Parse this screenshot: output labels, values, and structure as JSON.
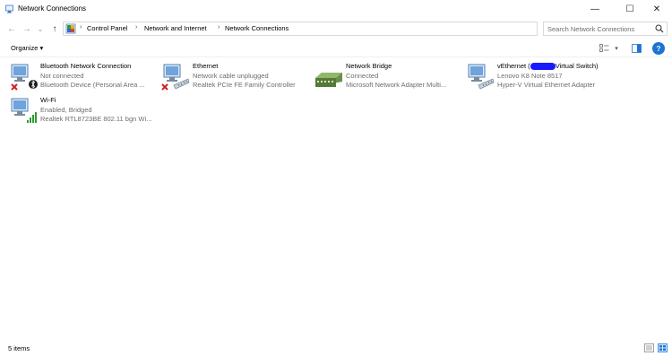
{
  "window": {
    "title": "Network Connections",
    "minimize": "—",
    "maximize": "☐",
    "close": "✕"
  },
  "nav": {
    "back": "←",
    "forward": "→",
    "recent": "⌄",
    "up": "↑"
  },
  "breadcrumb": {
    "separator": "›",
    "items": [
      "Control Panel",
      "Network and Internet",
      "Network Connections"
    ]
  },
  "search": {
    "placeholder": "Search Network Connections"
  },
  "command_bar": {
    "organize": "Organize ▾"
  },
  "connections": [
    {
      "name": "Bluetooth Network Connection",
      "status": "Not connected",
      "device": "Bluetooth Device (Personal Area ...",
      "icon": "bluetooth-network-icon"
    },
    {
      "name": "Ethernet",
      "status": "Network cable unplugged",
      "device": "Realtek PCIe FE Family Controller",
      "icon": "ethernet-icon"
    },
    {
      "name": "Network Bridge",
      "status": "Connected",
      "device": "Microsoft Network Adapter Multi...",
      "icon": "network-bridge-icon"
    },
    {
      "name_prefix": "vEthernet (",
      "name_suffix": "Virtual Switch)",
      "status": "Lenovo K8 Note 8517",
      "device": "Hyper-V Virtual Ethernet Adapter",
      "icon": "vethernet-icon"
    },
    {
      "name": "Wi-Fi",
      "status": "Enabled, Bridged",
      "device": "Realtek RTL8723BE 802.11 bgn Wi...",
      "icon": "wifi-icon"
    }
  ],
  "status_bar": {
    "item_count": "5 items"
  },
  "colors": {
    "accent": "#1b73d3",
    "error_x": "#d01f1f",
    "signal_green": "#2e9d2e"
  }
}
